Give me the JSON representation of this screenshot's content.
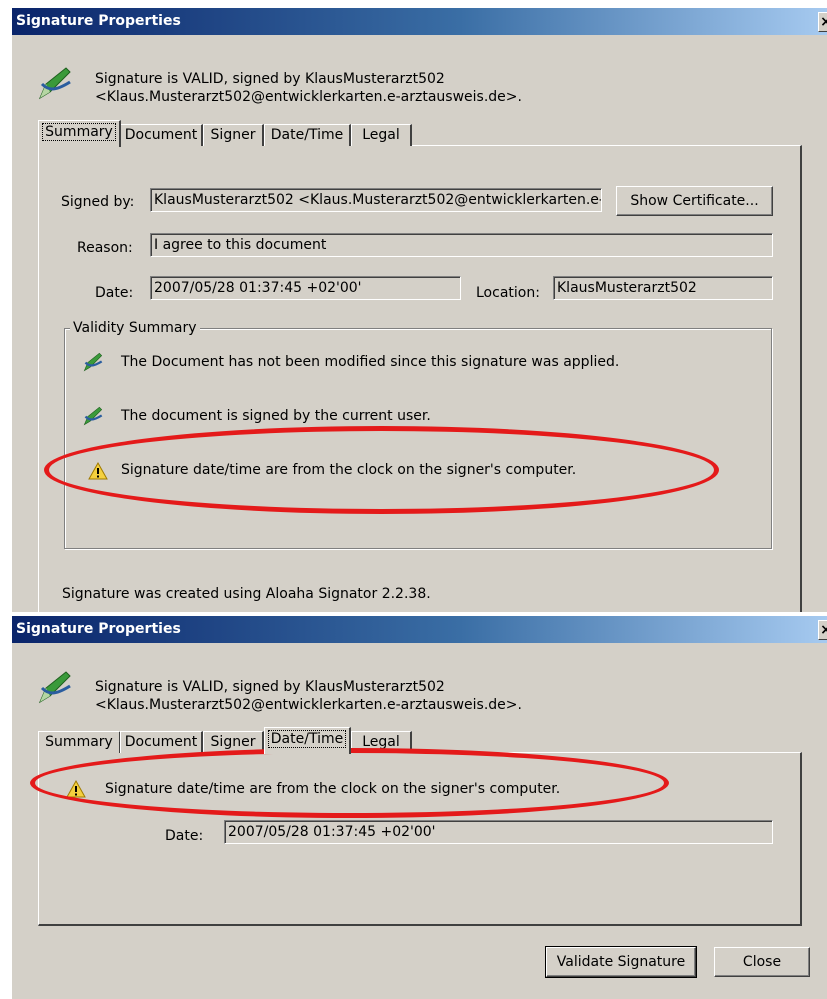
{
  "dialog1": {
    "title": "Signature Properties",
    "close_glyph": "×",
    "status_line1": "Signature is VALID, signed by KlausMusterarzt502",
    "status_line2": "<Klaus.Musterarzt502@entwicklerkarten.e-arztausweis.de>.",
    "tabs": [
      "Summary",
      "Document",
      "Signer",
      "Date/Time",
      "Legal"
    ],
    "active_tab": "Summary",
    "signed_by_label": "Signed by:",
    "signed_by_value": "KlausMusterarzt502 <Klaus.Musterarzt502@entwicklerkarten.e-a",
    "show_certificate_label": "Show Certificate...",
    "reason_label": "Reason:",
    "reason_value": "I agree to this document",
    "date_label": "Date:",
    "date_value": "2007/05/28 01:37:45 +02'00'",
    "location_label": "Location:",
    "location_value": "KlausMusterarzt502",
    "validity_title": "Validity Summary",
    "validity_items": [
      {
        "icon": "pen-check-icon",
        "text": "The Document has not been modified since this signature was applied."
      },
      {
        "icon": "pen-check-icon",
        "text": "The document is signed by the current user."
      },
      {
        "icon": "warning-icon",
        "text": "Signature date/time are from the clock on the signer's computer."
      }
    ],
    "created_using": "Signature was created using Aloaha Signator 2.2.38."
  },
  "dialog2": {
    "title": "Signature Properties",
    "close_glyph": "×",
    "status_line1": "Signature is VALID, signed by KlausMusterarzt502",
    "status_line2": "<Klaus.Musterarzt502@entwicklerkarten.e-arztausweis.de>.",
    "tabs": [
      "Summary",
      "Document",
      "Signer",
      "Date/Time",
      "Legal"
    ],
    "active_tab": "Date/Time",
    "warning_text": "Signature date/time are from the clock on the signer's computer.",
    "date_label": "Date:",
    "date_value": "2007/05/28 01:37:45 +02'00'",
    "validate_button": "Validate Signature",
    "close_button": "Close"
  },
  "colors": {
    "titlebar_start": "#0a246a",
    "titlebar_end": "#a6caf0",
    "dialog_bg": "#d4d0c8",
    "highlight_ring": "#e41a1a",
    "warning_yellow": "#f4d03f"
  }
}
